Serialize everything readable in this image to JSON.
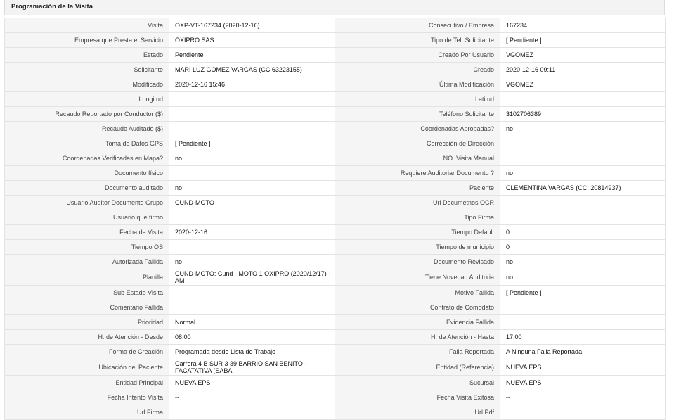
{
  "header": {
    "title": "Programación de la Visita"
  },
  "rows": [
    {
      "l1": "Visita",
      "v1": "OXP-VT-167234 (2020-12-16)",
      "l2": "Consecutivo / Empresa",
      "v2": "167234"
    },
    {
      "l1": "Empresa que Presta el Servicio",
      "v1": "OXIPRO SAS",
      "l2": "Tipo de Tel. Solicitante",
      "v2": "[ Pendiente ]"
    },
    {
      "l1": "Estado",
      "v1": "Pendiente",
      "l2": "Creado Por Usuario",
      "v2": "VGOMEZ"
    },
    {
      "l1": "Solicitante",
      "v1": "MARI LUZ GOMEZ VARGAS (CC 63223155)",
      "l2": "Creado",
      "v2": "2020-12-16 09:11"
    },
    {
      "l1": "Modificado",
      "v1": "2020-12-16 15:46",
      "l2": "Última Modificación",
      "v2": " VGOMEZ"
    },
    {
      "l1": "Longitud",
      "v1": "",
      "l2": "Latitud",
      "v2": ""
    },
    {
      "l1": "Recaudo Reportado por Conductor ($)",
      "v1": "",
      "l2": "Teléfono Solicitante",
      "v2": "3102706389"
    },
    {
      "l1": "Recaudo Auditado ($)",
      "v1": "",
      "l2": "Coordenadas Aprobadas?",
      "v2": " no"
    },
    {
      "l1": "Toma de Datos GPS",
      "v1": "[ Pendiente ]",
      "l2": "Corrección de Dirección",
      "v2": ""
    },
    {
      "l1": "Coordenadas Verificadas en Mapa?",
      "v1": " no",
      "l2": "NO. Visita Manual",
      "v2": ""
    },
    {
      "l1": "Documento físico",
      "v1": "",
      "l2": "Requiere Auditoriar Documento ?",
      "v2": " no"
    },
    {
      "l1": "Documento auditado",
      "v1": " no",
      "l2": "Paciente",
      "v2": "CLEMENTINA VARGAS (CC: 20814937)"
    },
    {
      "l1": "Usuario Auditor Documento Grupo",
      "v1": "CUND-MOTO",
      "l2": "Url Documetnos OCR",
      "v2": ""
    },
    {
      "l1": "Usuario que firmo",
      "v1": "",
      "l2": "Tipo Firma",
      "v2": ""
    },
    {
      "l1": "Fecha de Visita",
      "v1": " 2020-12-16",
      "l2": "Tiempo Default",
      "v2": "0"
    },
    {
      "l1": "Tiempo OS",
      "v1": "",
      "l2": "Tiempo de municipio",
      "v2": "0"
    },
    {
      "l1": "Autorizada Fallida",
      "v1": " no",
      "l2": "Documento Revisado",
      "v2": " no"
    },
    {
      "l1": "Planilla",
      "v1": "CUND-MOTO: Cund - MOTO 1 OXIPRO (2020/12/17) - AM",
      "l2": "Tiene Novedad Auditoria",
      "v2": " no"
    },
    {
      "l1": "Sub Estado Visita",
      "v1": "",
      "l2": "Motivo Fallida",
      "v2": "[ Pendiente ]"
    },
    {
      "l1": "Comentario Fallida",
      "v1": "",
      "l2": "Contrato de Comodato",
      "v2": ""
    },
    {
      "l1": "Prioridad",
      "v1": "Normal",
      "l2": "Evidencia Fallida",
      "v2": ""
    },
    {
      "l1": "H. de Atención - Desde",
      "v1": "08:00",
      "l2": "H. de Atención - Hasta",
      "v2": "17:00"
    },
    {
      "l1": "Forma de Creación",
      "v1": "Programada desde Lista de Trabajo",
      "l2": "Falla Reportada",
      "v2": "A Ninguna Falla Reportada"
    },
    {
      "l1": "Ubicación del Paciente",
      "v1": "Carrera 4 B SUR 3 39 BARRIO SAN BENITO - FACATATIVA (SABA",
      "l2": "Entidad (Referencia)",
      "v2": "NUEVA EPS"
    },
    {
      "l1": "Entidad Principal",
      "v1": "NUEVA EPS",
      "l2": "Sucursal",
      "v2": "NUEVA EPS"
    },
    {
      "l1": "Fecha Intento Visita",
      "v1": " --",
      "l2": "Fecha Visita Exitosa",
      "v2": " --"
    },
    {
      "l1": "Url Firma",
      "v1": "",
      "l2": "Url Pdf",
      "v2": ""
    }
  ]
}
